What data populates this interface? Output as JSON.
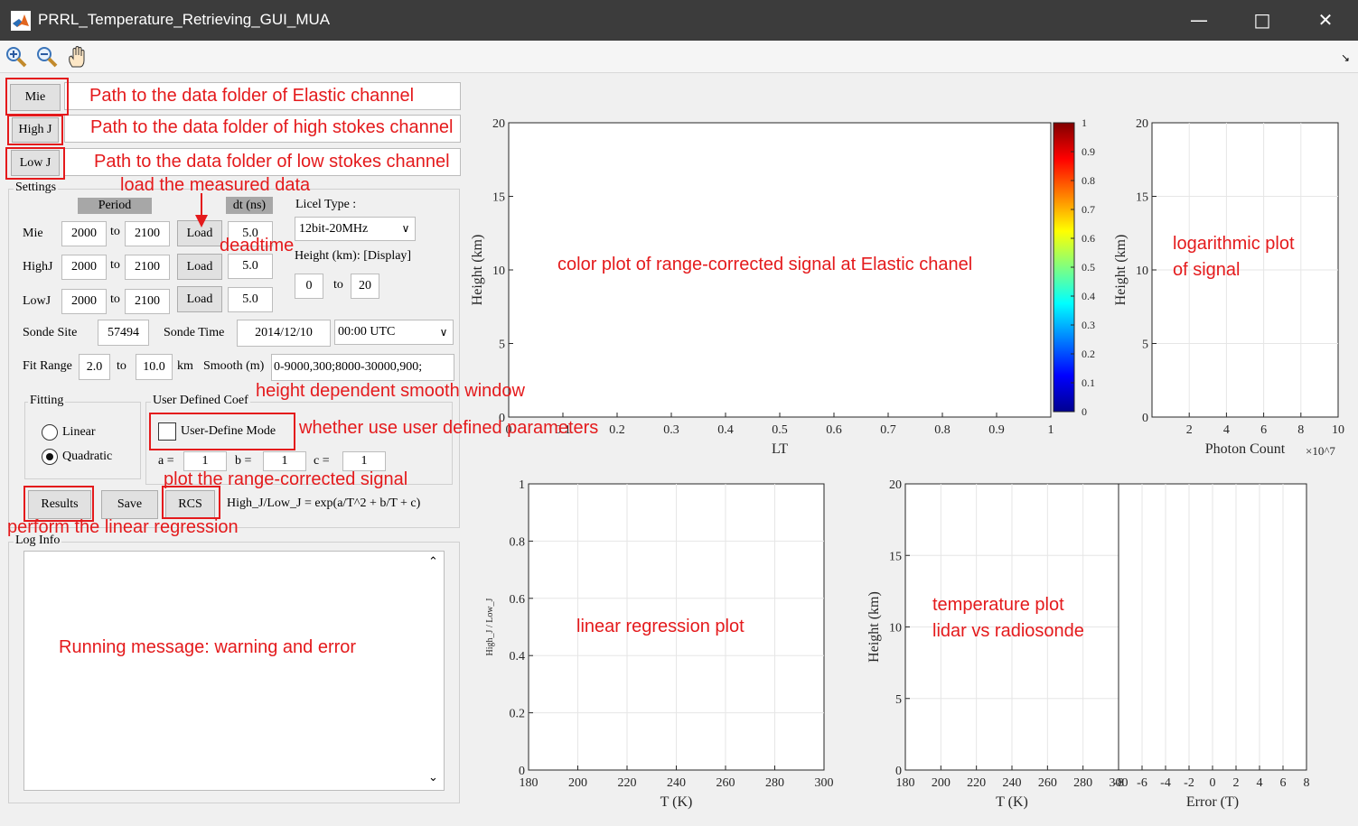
{
  "window": {
    "title": "PRRL_Temperature_Retrieving_GUI_MUA"
  },
  "toolbar": {
    "zoom_in": "zoom-in-icon",
    "zoom_out": "zoom-out-icon",
    "pan": "pan-hand-icon"
  },
  "paths": {
    "mie_button": "Mie",
    "highj_button": "High J",
    "lowj_button": "Low J",
    "mie_path": "",
    "highj_path": "",
    "lowj_path": ""
  },
  "settings": {
    "title": "Settings",
    "period_label": "Period",
    "dt_label": "dt (ns)",
    "to": "to",
    "rows": [
      {
        "label": "Mie",
        "from": "2000",
        "to": "2100",
        "load": "Load",
        "dt": "5.0"
      },
      {
        "label": "HighJ",
        "from": "2000",
        "to": "2100",
        "load": "Load",
        "dt": "5.0"
      },
      {
        "label": "LowJ",
        "from": "2000",
        "to": "2100",
        "load": "Load",
        "dt": "5.0"
      }
    ],
    "licel_label": "Licel Type :",
    "licel_value": "12bit-20MHz",
    "height_label": "Height (km): [Display]",
    "height_from": "0",
    "height_to": "20",
    "sonde_site_label": "Sonde Site",
    "sonde_site": "57494",
    "sonde_time_label": "Sonde Time",
    "sonde_date": "2014/12/10",
    "sonde_hour": "00:00 UTC",
    "fit_range_label": "Fit Range",
    "fit_from": "2.0",
    "fit_to": "10.0",
    "km": "km",
    "smooth_label": "Smooth (m)",
    "smooth_value": "0-9000,300;8000-30000,900;"
  },
  "fitting": {
    "title": "Fitting",
    "linear": "Linear",
    "quadratic": "Quadratic",
    "selected": "Quadratic"
  },
  "coef": {
    "title": "User Defined Coef",
    "mode_label": "User-Define Mode",
    "a_label": "a =",
    "a": "1",
    "b_label": "b =",
    "b": "1",
    "c_label": "c =",
    "c": "1"
  },
  "actions": {
    "results": "Results",
    "save": "Save",
    "rcs": "RCS",
    "formula": "High_J/Low_J = exp(a/T^2 + b/T + c)"
  },
  "log": {
    "title": "Log Info",
    "content": ""
  },
  "annotations": {
    "mie_path": "Path to the data folder of Elastic channel",
    "highj_path": "Path to the data folder of high stokes channel",
    "lowj_path": "Path to the data folder of low stokes channel",
    "load": "load the measured data",
    "deadtime": "deadtime",
    "smooth": "height dependent smooth window",
    "user_defined": "whether use user defined parameters",
    "rcs": "plot the range-corrected signal",
    "regression": "perform the linear regression",
    "log": "Running message: warning and error",
    "color_plot": "color plot of range-corrected signal at Elastic chanel",
    "log_plot_1": "logarithmic plot",
    "log_plot_2": "of signal",
    "linreg_plot": "linear regression plot",
    "temp_plot_1": "temperature plot",
    "temp_plot_2": "lidar vs radiosonde"
  },
  "chart_data": [
    {
      "type": "heatmap",
      "xlabel": "LT",
      "ylabel": "Height (km)",
      "xlim": [
        0,
        1
      ],
      "ylim": [
        0,
        20
      ],
      "x_ticks": [
        "0",
        "0.1",
        "0.2",
        "0.3",
        "0.4",
        "0.5",
        "0.6",
        "0.7",
        "0.8",
        "0.9",
        "1"
      ],
      "y_ticks": [
        "0",
        "5",
        "10",
        "15",
        "20"
      ],
      "colorbar": {
        "range": [
          0,
          1
        ],
        "ticks": [
          "0",
          "0.1",
          "0.2",
          "0.3",
          "0.4",
          "0.5",
          "0.6",
          "0.7",
          "0.8",
          "0.9",
          "1"
        ],
        "colormap": "jet"
      },
      "values": []
    },
    {
      "type": "line",
      "xlabel": "Photon Count",
      "ylabel": "Height (km)",
      "x_exponent": "×10^7",
      "xlim": [
        0,
        10
      ],
      "ylim": [
        0,
        20
      ],
      "x_ticks": [
        "2",
        "4",
        "6",
        "8",
        "10"
      ],
      "y_ticks": [
        "0",
        "5",
        "10",
        "15",
        "20"
      ],
      "grid": true,
      "series": []
    },
    {
      "type": "scatter",
      "xlabel": "T (K)",
      "ylabel": "High_J / Low_J",
      "xlim": [
        180,
        300
      ],
      "ylim": [
        0,
        1
      ],
      "x_ticks": [
        "180",
        "200",
        "220",
        "240",
        "260",
        "280",
        "300"
      ],
      "y_ticks": [
        "0",
        "0.2",
        "0.4",
        "0.6",
        "0.8",
        "1"
      ],
      "grid": true,
      "series": []
    },
    {
      "type": "line",
      "xlabel": "T (K)",
      "ylabel": "Height (km)",
      "xlim": [
        180,
        300
      ],
      "ylim": [
        0,
        20
      ],
      "x_ticks": [
        "180",
        "200",
        "220",
        "240",
        "260",
        "280",
        "300"
      ],
      "y_ticks": [
        "0",
        "5",
        "10",
        "15",
        "20"
      ],
      "grid": true,
      "series": []
    },
    {
      "type": "line",
      "xlabel": "Error (T)",
      "ylabel": "",
      "xlim": [
        -8,
        8
      ],
      "ylim": [
        0,
        20
      ],
      "x_ticks": [
        "-8",
        "-6",
        "-4",
        "-2",
        "0",
        "2",
        "4",
        "6",
        "8"
      ],
      "grid": true,
      "series": []
    }
  ]
}
